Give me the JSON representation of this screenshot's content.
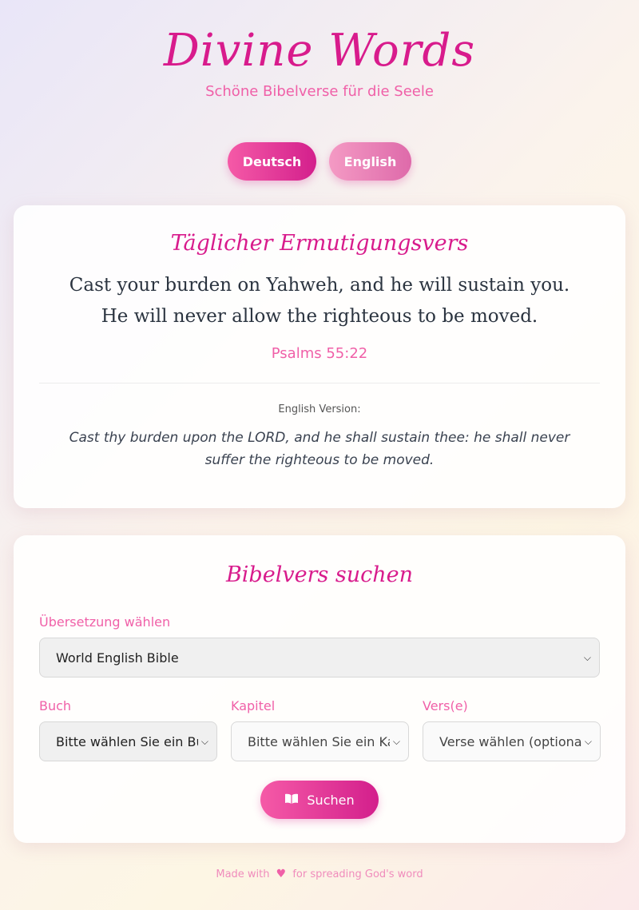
{
  "header": {
    "title": "Divine Words",
    "subtitle": "Schöne Bibelverse für die Seele"
  },
  "language": {
    "deutsch_label": "Deutsch",
    "english_label": "English",
    "active": "Deutsch"
  },
  "daily": {
    "title": "Täglicher Ermutigungsvers",
    "verse": "Cast your burden on Yahweh, and he will sustain you. He will never allow the righteous to be moved.",
    "reference": "Psalms 55:22",
    "english_label": "English Version:",
    "english_text": "Cast thy burden upon the LORD, and he shall sustain thee: he shall never suffer the righteous to be moved."
  },
  "search": {
    "title": "Bibelvers suchen",
    "translation_label": "Übersetzung wählen",
    "translation_value": "World English Bible",
    "book_label": "Buch",
    "book_value": "Bitte wählen Sie ein Buch",
    "chapter_label": "Kapitel",
    "chapter_value": "Bitte wählen Sie ein Kapitel",
    "verse_label": "Vers(e)",
    "verse_value": "Verse wählen (optional)",
    "button_label": "Suchen",
    "button_icon": "book-open-icon"
  },
  "footer": {
    "prefix": "Made with",
    "heart_icon": "heart-icon",
    "suffix": "for spreading God's word"
  },
  "colors": {
    "accent": "#d81b8c",
    "accent_light": "#f060a8"
  }
}
